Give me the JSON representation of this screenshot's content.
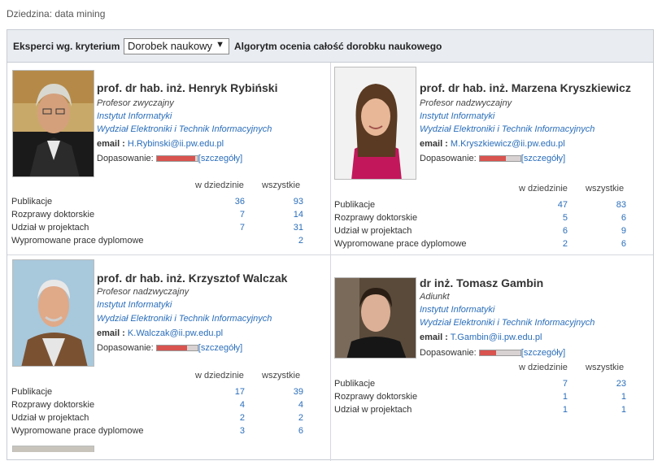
{
  "domain_label": "Dziedzina: data mining",
  "toolbar": {
    "criterion_label": "Eksperci wg. kryterium",
    "select_value": "Dorobek naukowy",
    "algorithm_label": "Algorytm ocenia całość dorobku naukowego"
  },
  "common": {
    "email_label": "email :",
    "match_label": "Dopasowanie:",
    "details_link": "[szczegóły]",
    "col_field": "w dziedzinie",
    "col_all": "wszystkie",
    "row_pub": "Publikacje",
    "row_phd": "Rozprawy doktorskie",
    "row_proj": "Udział w projektach",
    "row_thesis": "Wypromowane prace dyplomowe"
  },
  "experts": [
    {
      "name": "prof. dr hab. inż. Henryk Rybiński",
      "title": "Profesor zwyczajny",
      "institute": "Instytut Informatyki",
      "faculty": "Wydział Elektroniki i Technik Informacyjnych",
      "email": "H.Rybinski@ii.pw.edu.pl",
      "match": 0.95,
      "stats": {
        "pub": [
          "36",
          "93"
        ],
        "phd": [
          "7",
          "14"
        ],
        "proj": [
          "7",
          "31"
        ],
        "thesis": [
          "",
          "2"
        ]
      }
    },
    {
      "name": "prof. dr hab. inż. Marzena Kryszkiewicz",
      "title": "Profesor nadzwyczajny",
      "institute": "Instytut Informatyki",
      "faculty": "Wydział Elektroniki i Technik Informacyjnych",
      "email": "M.Kryszkiewicz@ii.pw.edu.pl",
      "match": 0.65,
      "stats": {
        "pub": [
          "47",
          "83"
        ],
        "phd": [
          "5",
          "6"
        ],
        "proj": [
          "6",
          "9"
        ],
        "thesis": [
          "2",
          "6"
        ]
      }
    },
    {
      "name": "prof. dr hab. inż. Krzysztof Walczak",
      "title": "Profesor nadzwyczajny",
      "institute": "Instytut Informatyki",
      "faculty": "Wydział Elektroniki i Technik Informacyjnych",
      "email": "K.Walczak@ii.pw.edu.pl",
      "match": 0.75,
      "stats": {
        "pub": [
          "17",
          "39"
        ],
        "phd": [
          "4",
          "4"
        ],
        "proj": [
          "2",
          "2"
        ],
        "thesis": [
          "3",
          "6"
        ]
      }
    },
    {
      "name": "dr inż. Tomasz Gambin",
      "title": "Adiunkt",
      "institute": "Instytut Informatyki",
      "faculty": "Wydział Elektroniki i Technik Informacyjnych",
      "email": "T.Gambin@ii.pw.edu.pl",
      "match": 0.4,
      "stats": {
        "pub": [
          "7",
          "23"
        ],
        "phd": [
          "1",
          "1"
        ],
        "proj": [
          "1",
          "1"
        ]
      }
    }
  ]
}
